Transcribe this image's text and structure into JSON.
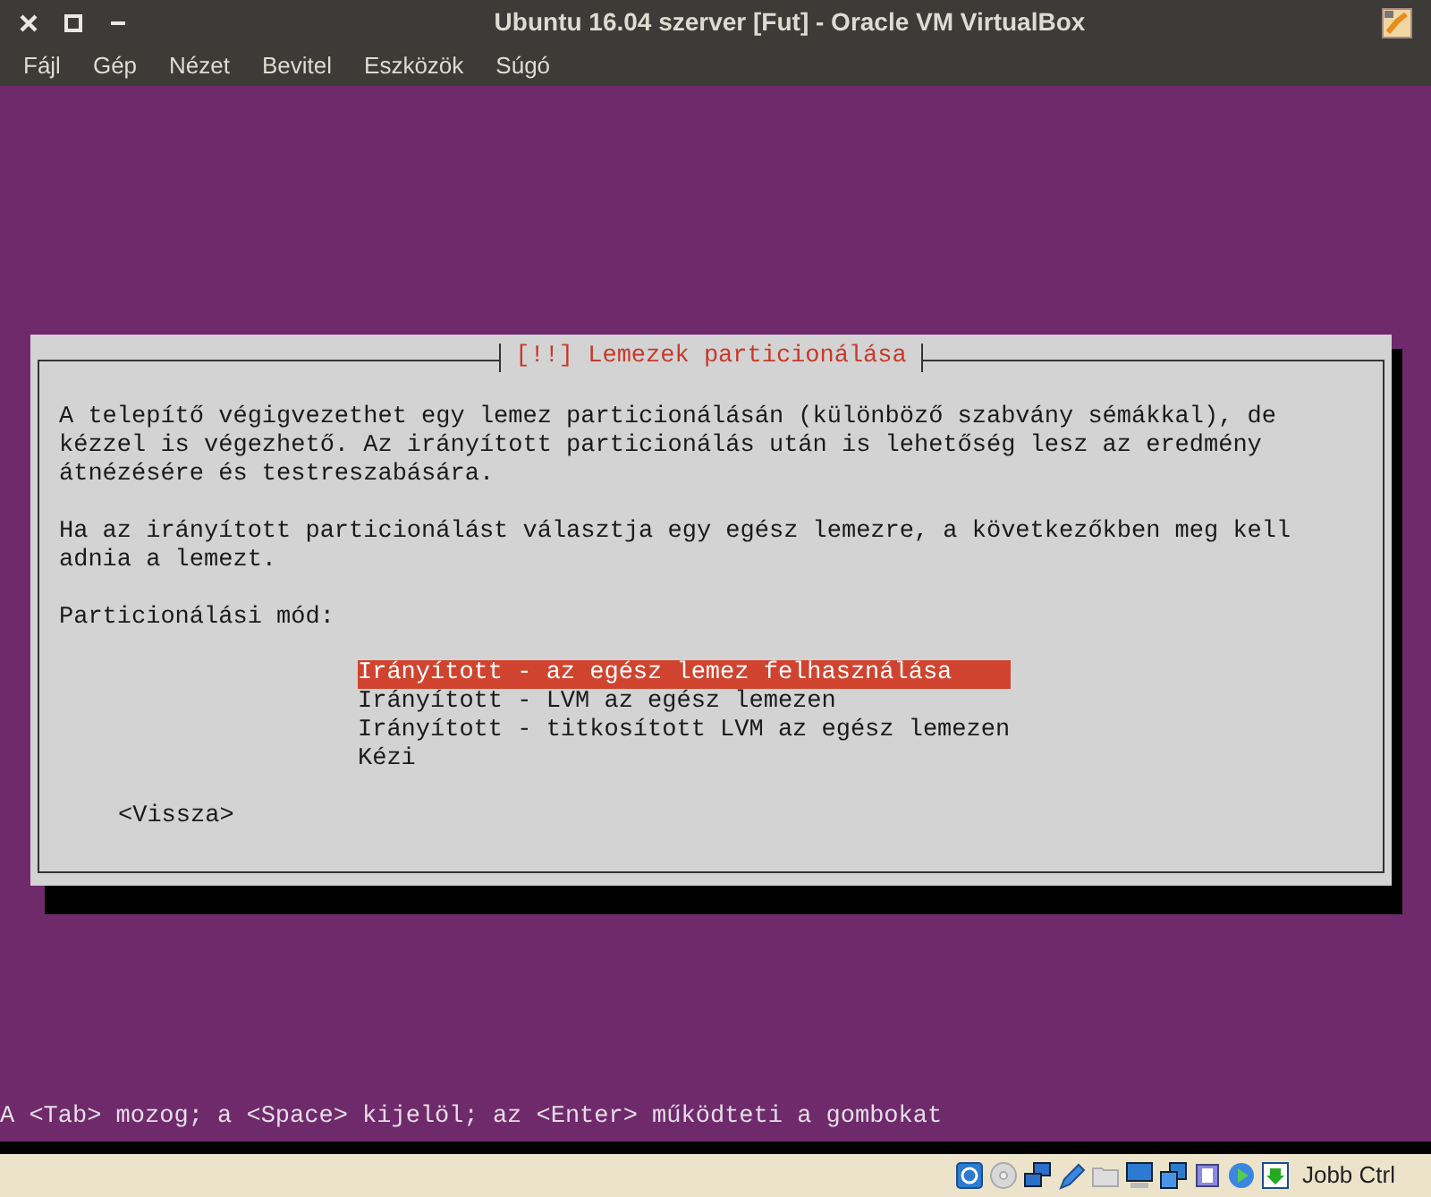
{
  "window": {
    "title": "Ubuntu 16.04 szerver [Fut] - Oracle VM VirtualBox"
  },
  "menu": [
    "Fájl",
    "Gép",
    "Nézet",
    "Bevitel",
    "Eszközök",
    "Súgó"
  ],
  "dialog": {
    "title": "[!!] Lemezek particionálása",
    "paragraphs": [
      "A telepítő végigvezethet egy lemez particionálásán (különböző szabvány sémákkal), de\nkézzel is végezhető. Az irányított particionálás után is lehetőség lesz az eredmény\nátnézésére és testreszabására.",
      "Ha az irányított particionálást választja egy egész lemezre, a következőkben meg kell\nadnia a lemezt."
    ],
    "prompt": "Particionálási mód:",
    "options": [
      {
        "label": "Irányított - az egész lemez felhasználása",
        "selected": true
      },
      {
        "label": "Irányított - LVM az egész lemezen",
        "selected": false
      },
      {
        "label": "Irányított - titkosított LVM az egész lemezen",
        "selected": false
      },
      {
        "label": "Kézi",
        "selected": false
      }
    ],
    "back_button": "<Vissza>"
  },
  "hint": "A <Tab> mozog; a <Space> kijelöl; az <Enter> működteti a gombokat",
  "status_bar": {
    "host_key": "Jobb Ctrl"
  }
}
